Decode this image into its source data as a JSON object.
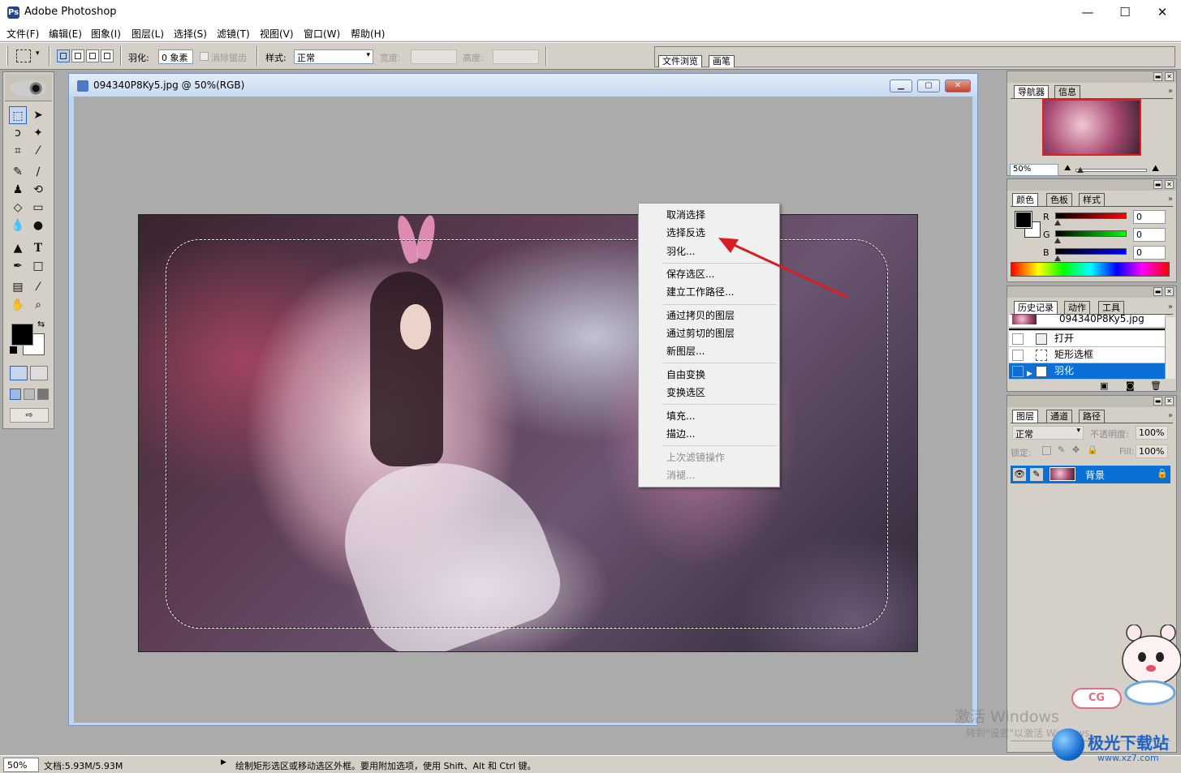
{
  "window": {
    "app_icon": "Ps",
    "title": "Adobe Photoshop",
    "minimize": "—",
    "maximize": "☐",
    "close": "✕"
  },
  "menu": [
    "文件(F)",
    "编辑(E)",
    "图象(I)",
    "图层(L)",
    "选择(S)",
    "滤镜(T)",
    "视图(V)",
    "窗口(W)",
    "帮助(H)"
  ],
  "options": {
    "feather_label": "羽化:",
    "feather_value": "0 象素",
    "antialias_label": "消除锯齿",
    "style_label": "样式:",
    "style_value": "正常",
    "width_label": "宽度:",
    "height_label": "高度:",
    "well_tabs": [
      "文件浏览",
      "画笔"
    ]
  },
  "document": {
    "title": "094340P8Ky5.jpg @ 50%(RGB)"
  },
  "context_menu": {
    "items": [
      "取消选择",
      "选择反选",
      "羽化...",
      "保存选区...",
      "建立工作路径...",
      "通过拷贝的图层",
      "通过剪切的图层",
      "新图层...",
      "自由变换",
      "变换选区",
      "填充...",
      "描边...",
      "上次滤镜操作",
      "消褪..."
    ],
    "highlight_item": "选择反选",
    "arrow_color": "#d81e1e"
  },
  "navigator": {
    "tabs": [
      "导航器",
      "信息"
    ],
    "zoom": "50%"
  },
  "color": {
    "tabs": [
      "颜色",
      "色板",
      "样式"
    ],
    "r_label": "R",
    "g_label": "G",
    "b_label": "B",
    "r": "0",
    "g": "0",
    "b": "0"
  },
  "history": {
    "tabs": [
      "历史记录",
      "动作",
      "工具"
    ],
    "snapshot": "094340P8Ky5.jpg",
    "items": [
      "打开",
      "矩形选框",
      "羽化"
    ],
    "selected": "羽化"
  },
  "layers": {
    "tabs": [
      "图层",
      "通道",
      "路径"
    ],
    "blend_mode": "正常",
    "opacity_label": "不透明度:",
    "opacity": "100%",
    "lock_label": "锁定:",
    "fill_label": "Fill:",
    "fill": "100%",
    "layer_name": "背景"
  },
  "status": {
    "zoom": "50%",
    "doc_size": "文档:5.93M/5.93M",
    "hint": "绘制矩形选区或移动选区外框。要用附加选项，使用 Shift、Alt 和 Ctrl 键。"
  },
  "overlay": {
    "activate_title": "激活 Windows",
    "activate_sub": "转到\"设置\"以激活 Windows。",
    "brand": "极光下载站",
    "brand_url": "www.xz7.com"
  }
}
